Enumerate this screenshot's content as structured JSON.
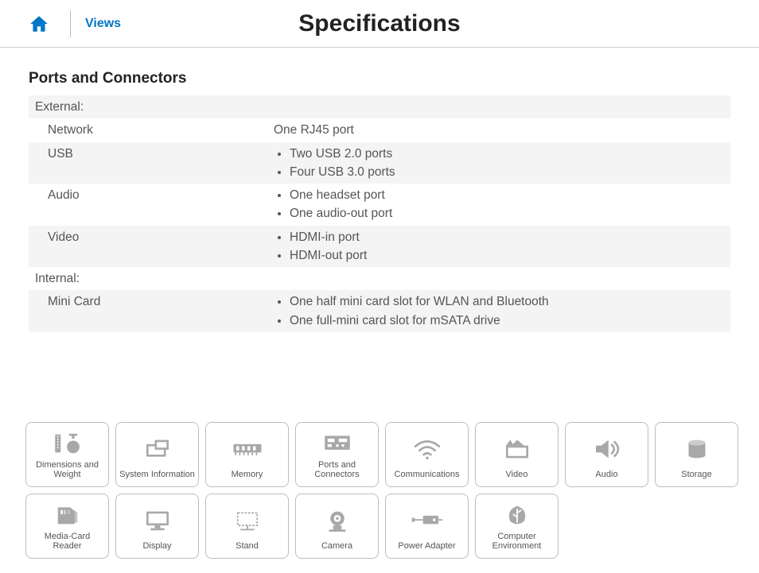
{
  "header": {
    "views_label": "Views",
    "title": "Specifications"
  },
  "section": {
    "title": "Ports and Connectors",
    "groups": [
      {
        "heading": "External:",
        "rows": [
          {
            "label": "Network",
            "values": [
              "One RJ45 port"
            ],
            "bulleted": false
          },
          {
            "label": "USB",
            "values": [
              "Two USB 2.0 ports",
              "Four USB 3.0 ports"
            ],
            "bulleted": true
          },
          {
            "label": "Audio",
            "values": [
              "One headset port",
              "One audio-out port"
            ],
            "bulleted": true
          },
          {
            "label": "Video",
            "values": [
              "HDMI-in port",
              "HDMI-out port"
            ],
            "bulleted": true
          }
        ]
      },
      {
        "heading": "Internal:",
        "rows": [
          {
            "label": "Mini Card",
            "values": [
              "One half mini card slot for WLAN and Bluetooth",
              "One full-mini card slot for mSATA drive"
            ],
            "bulleted": true
          }
        ]
      }
    ]
  },
  "tiles": [
    {
      "label": "Dimensions and Weight",
      "icon": "dimensions-icon"
    },
    {
      "label": "System Information",
      "icon": "system-info-icon"
    },
    {
      "label": "Memory",
      "icon": "memory-icon"
    },
    {
      "label": "Ports and Connectors",
      "icon": "ports-icon"
    },
    {
      "label": "Communications",
      "icon": "wifi-icon"
    },
    {
      "label": "Video",
      "icon": "video-icon"
    },
    {
      "label": "Audio",
      "icon": "audio-icon"
    },
    {
      "label": "Storage",
      "icon": "storage-icon"
    },
    {
      "label": "Media-Card Reader",
      "icon": "media-card-icon"
    },
    {
      "label": "Display",
      "icon": "display-icon"
    },
    {
      "label": "Stand",
      "icon": "stand-icon"
    },
    {
      "label": "Camera",
      "icon": "camera-icon"
    },
    {
      "label": "Power Adapter",
      "icon": "power-adapter-icon"
    },
    {
      "label": "Computer Environment",
      "icon": "environment-icon"
    }
  ]
}
